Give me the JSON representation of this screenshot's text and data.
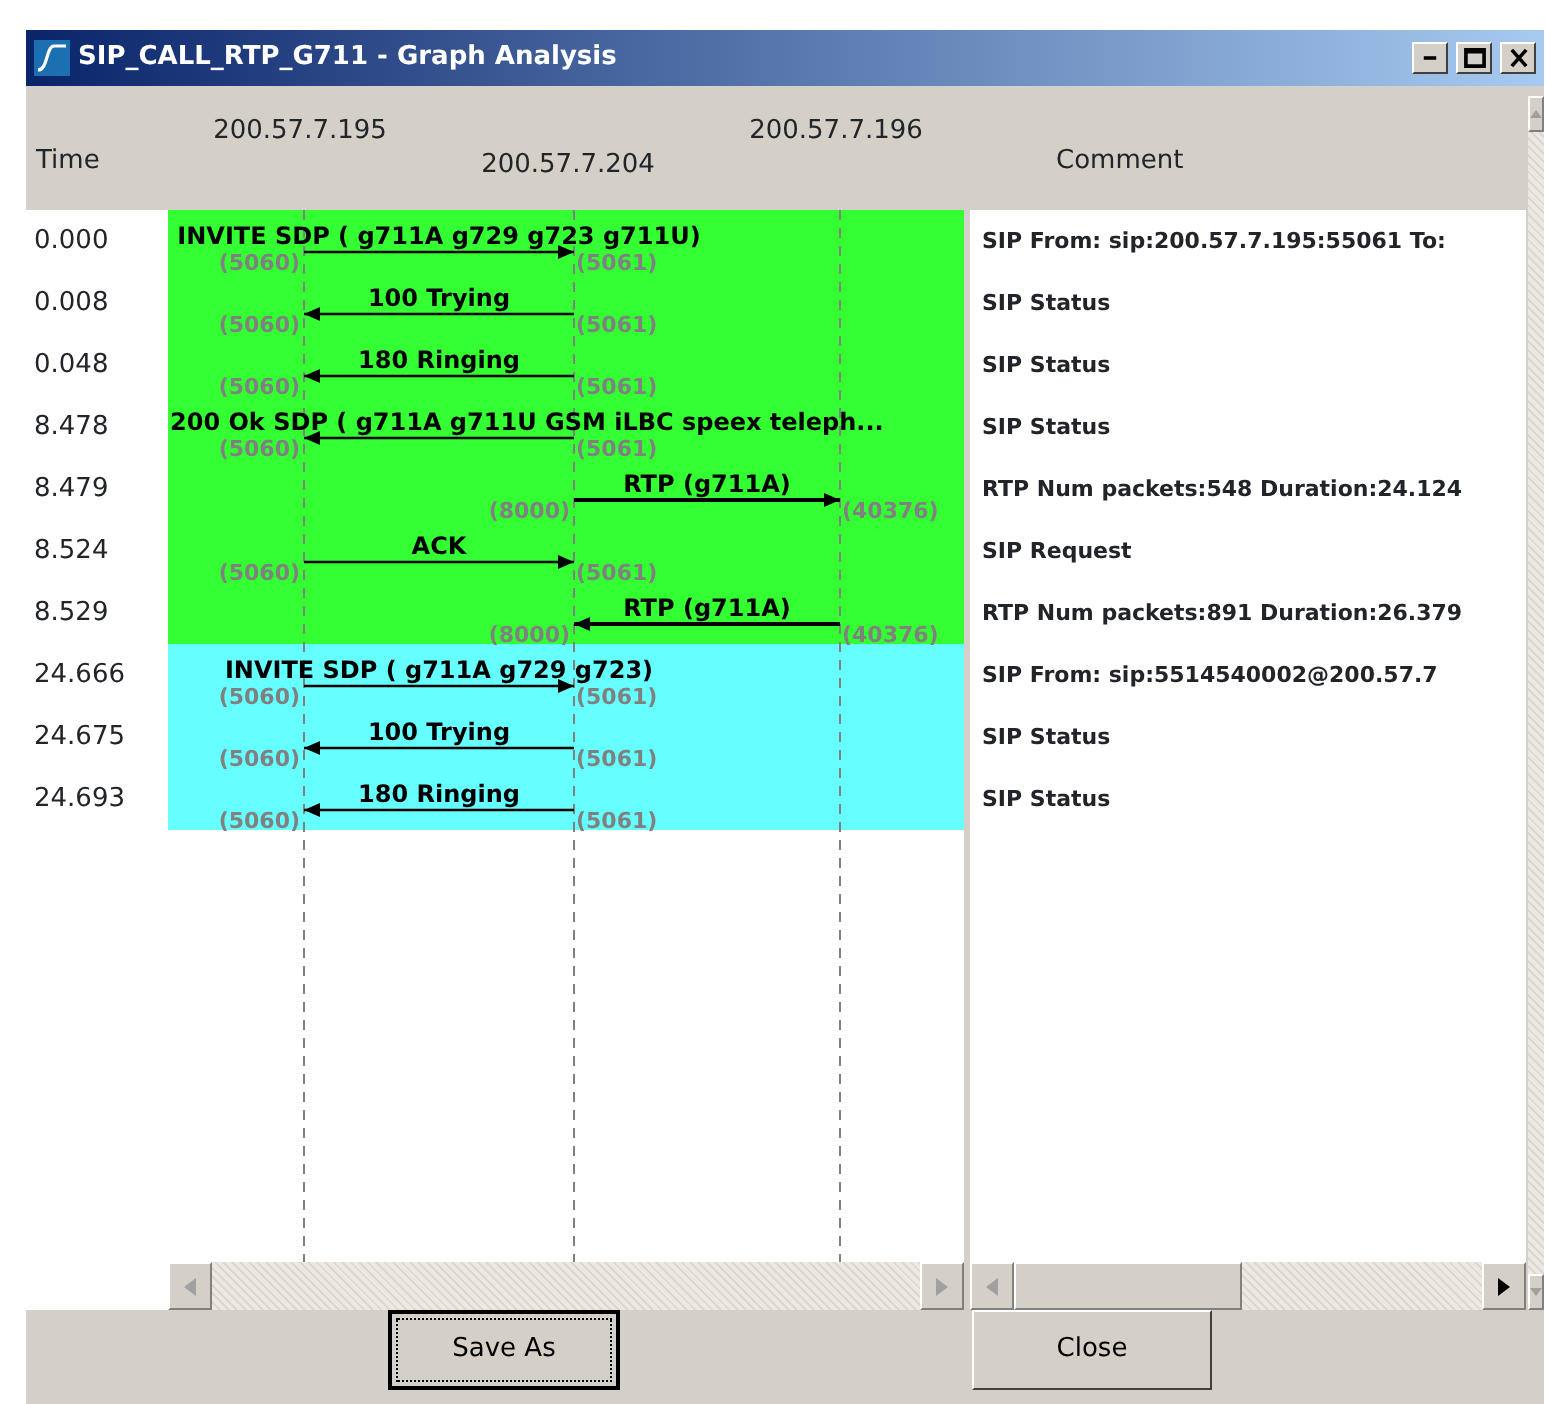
{
  "window": {
    "title": "SIP_CALL_RTP_G711 - Graph Analysis"
  },
  "header": {
    "time_label": "Time",
    "comment_label": "Comment",
    "nodes": [
      "200.57.7.195",
      "200.57.7.204",
      "200.57.7.196"
    ]
  },
  "messages": [
    {
      "time": "0.000",
      "label": "INVITE SDP ( g711A g729 g723 g711U)",
      "kind": "sip",
      "rightward": true,
      "left_port": "(5060)",
      "right_port": "(5061)",
      "color": "#33ff33",
      "comment": "SIP From: sip:200.57.7.195:55061 To:"
    },
    {
      "time": "0.008",
      "label": "100 Trying",
      "kind": "sip",
      "rightward": false,
      "left_port": "(5060)",
      "right_port": "(5061)",
      "color": "#33ff33",
      "comment": "SIP Status"
    },
    {
      "time": "0.048",
      "label": "180 Ringing",
      "kind": "sip",
      "rightward": false,
      "left_port": "(5060)",
      "right_port": "(5061)",
      "color": "#33ff33",
      "comment": "SIP Status"
    },
    {
      "time": "8.478",
      "label": "200 Ok SDP ( g711A g711U GSM iLBC speex teleph...",
      "kind": "sip",
      "rightward": false,
      "left_port": "(5060)",
      "right_port": "(5061)",
      "color": "#33ff33",
      "comment": "SIP Status"
    },
    {
      "time": "8.479",
      "label": "RTP (g711A)",
      "kind": "rtp",
      "rightward": true,
      "left_port": "(8000)",
      "right_port": "(40376)",
      "color": "#33ff33",
      "comment": "RTP Num packets:548  Duration:24.124"
    },
    {
      "time": "8.524",
      "label": "ACK",
      "kind": "sip",
      "rightward": true,
      "left_port": "(5060)",
      "right_port": "(5061)",
      "color": "#33ff33",
      "comment": "SIP Request"
    },
    {
      "time": "8.529",
      "label": "RTP (g711A)",
      "kind": "rtp",
      "rightward": false,
      "left_port": "(8000)",
      "right_port": "(40376)",
      "color": "#33ff33",
      "comment": "RTP Num packets:891  Duration:26.379"
    },
    {
      "time": "24.666",
      "label": "INVITE SDP ( g711A g729 g723)",
      "kind": "sip",
      "rightward": true,
      "left_port": "(5060)",
      "right_port": "(5061)",
      "color": "#66ffff",
      "comment": "SIP From: sip:5514540002@200.57.7"
    },
    {
      "time": "24.675",
      "label": "100 Trying",
      "kind": "sip",
      "rightward": false,
      "left_port": "(5060)",
      "right_port": "(5061)",
      "color": "#66ffff",
      "comment": "SIP Status"
    },
    {
      "time": "24.693",
      "label": "180 Ringing",
      "kind": "sip",
      "rightward": false,
      "left_port": "(5060)",
      "right_port": "(5061)",
      "color": "#66ffff",
      "comment": "SIP Status"
    }
  ],
  "buttons": [
    {
      "label": "Save As",
      "focused": true
    },
    {
      "label": "Close",
      "focused": false
    }
  ]
}
